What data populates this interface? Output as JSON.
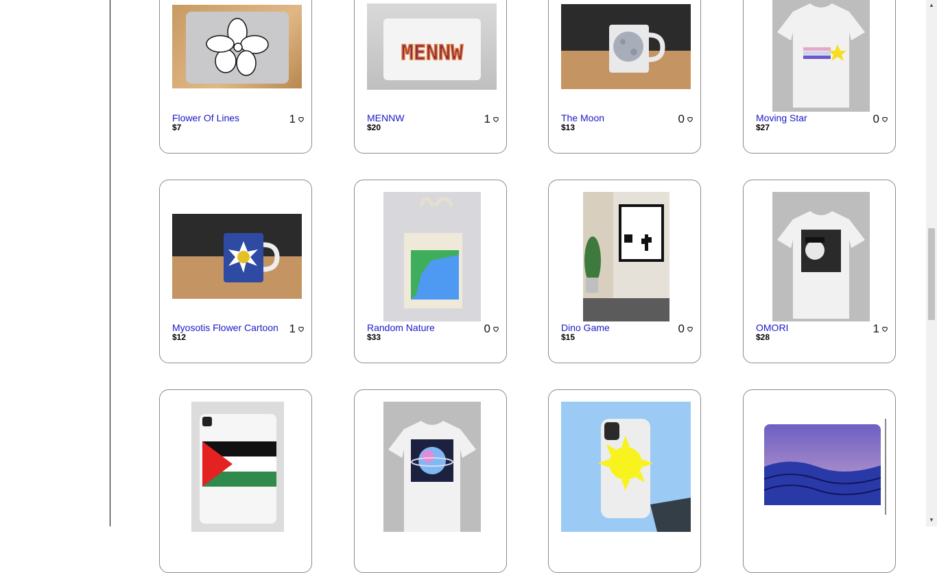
{
  "products": [
    {
      "name": "Flower Of Lines",
      "price": "$7",
      "likes": "1"
    },
    {
      "name": "MENNW",
      "price": "$20",
      "likes": "1"
    },
    {
      "name": "The Moon",
      "price": "$13",
      "likes": "0"
    },
    {
      "name": "Moving Star",
      "price": "$27",
      "likes": "0"
    },
    {
      "name": "Myosotis Flower Cartoon",
      "price": "$12",
      "likes": "1"
    },
    {
      "name": "Random Nature",
      "price": "$33",
      "likes": "0"
    },
    {
      "name": "Dino Game",
      "price": "$15",
      "likes": "0"
    },
    {
      "name": "OMORI",
      "price": "$28",
      "likes": "1"
    }
  ],
  "colors": {
    "link": "#1a17c9",
    "border": "#8a8a8a"
  },
  "icons": {
    "like": "heart-outline-icon"
  }
}
